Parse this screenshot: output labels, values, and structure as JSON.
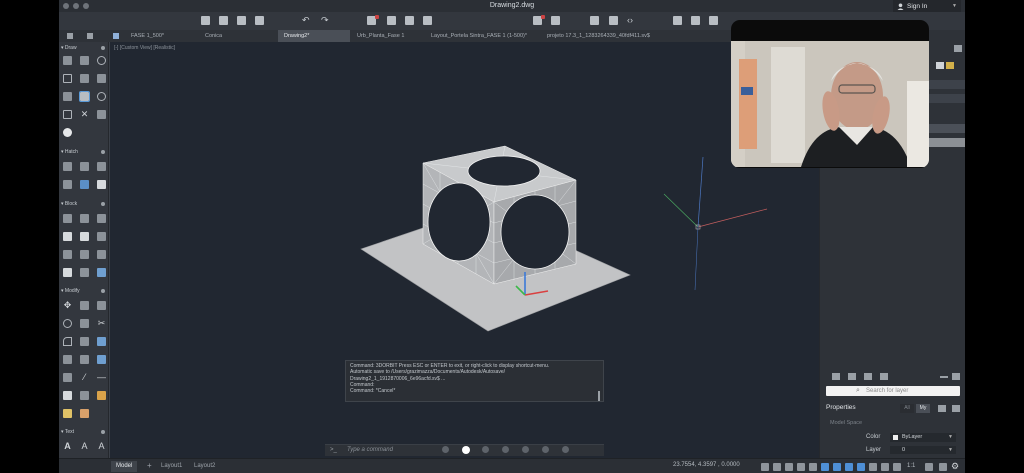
{
  "window": {
    "title": "Drawing2.dwg",
    "sign_in": "Sign In"
  },
  "tabs": [
    {
      "label": "FASE 1_500*"
    },
    {
      "label": "Conica"
    },
    {
      "label": "Drawing2*"
    },
    {
      "label": "Urb_Planta_Fase 1"
    },
    {
      "label": "Layout_Portela Sintra_FASE 1 (1-500)*"
    },
    {
      "label": "projeto 17.3_1_1283264339_40fdf411.sv$"
    }
  ],
  "palette": {
    "sections": [
      {
        "label": "Draw"
      },
      {
        "label": "Hatch"
      },
      {
        "label": "Block"
      },
      {
        "label": "Modify"
      },
      {
        "label": "Text"
      }
    ]
  },
  "viewport": {
    "label": "[-] [Custom View] [Realistic]"
  },
  "command": {
    "history": [
      "Command: 3DORBIT Press ESC or ENTER to exit, or right-click to display shortcut-menu.",
      "Automatic save to /Users/grazimazza/Documents/Autodesk/Autosave/",
      "Drawing2_1_1912870006_6e96acfd.sv$ ...",
      "Command:",
      "Command: *Cancel*"
    ],
    "prompt": ">_",
    "placeholder": "Type a command"
  },
  "pager": {
    "count": 7,
    "active": 1
  },
  "layers": {
    "search_placeholder": "Search for layer"
  },
  "properties": {
    "title": "Properties",
    "toggle_a": "All",
    "toggle_b": "My",
    "context": "Model Space",
    "rows": [
      {
        "label": "Color",
        "value": "ByLayer"
      },
      {
        "label": "Layer",
        "value": "0"
      }
    ]
  },
  "status": {
    "tabs": [
      {
        "label": "Model"
      },
      {
        "label": "Layout1"
      },
      {
        "label": "Layout2"
      }
    ],
    "coords": "23.7554, 4.3597 , 0.0000",
    "scale": "1:1"
  },
  "colors": {
    "app_bg": "#3b4048",
    "canvas_bg": "#212731",
    "accent": "#4e8fd6",
    "axis_x": "#d94040",
    "axis_y": "#3cb84a",
    "axis_z": "#3c7ad8"
  }
}
